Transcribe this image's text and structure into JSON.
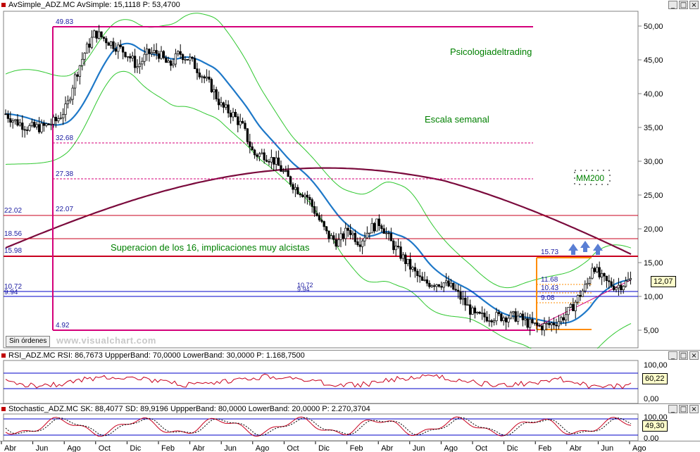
{
  "main_panel": {
    "header": {
      "name": "AvSimple_ADZ.MC",
      "indicator": "AvSimple: 15,1118",
      "price": "P: 53,4700"
    },
    "annotations": {
      "brand": "Psicologiadeltrading",
      "scale": "Escala semanal",
      "breakout": "Superacion de los 16, implicaciones muy alcistas",
      "ma_label": "MM200"
    },
    "levels": [
      {
        "label": "49.83",
        "value": 49.83
      },
      {
        "label": "32.68",
        "value": 32.68
      },
      {
        "label": "27.38",
        "value": 27.38
      },
      {
        "label": "22.07",
        "value": 22.07
      },
      {
        "label": "22.02",
        "value": 22.02
      },
      {
        "label": "18.56",
        "value": 18.56
      },
      {
        "label": "15.98",
        "value": 15.98
      },
      {
        "label": "15.73",
        "value": 15.73
      },
      {
        "label": "11.68",
        "value": 11.68
      },
      {
        "label": "10.72",
        "value": 10.72
      },
      {
        "label": "10.43",
        "value": 10.43
      },
      {
        "label": "9.94",
        "value": 9.94
      },
      {
        "label": "9.08",
        "value": 9.08
      },
      {
        "label": "4.92",
        "value": 4.92
      }
    ],
    "y_ticks": [
      "50,00",
      "45,00",
      "40,00",
      "35,00",
      "30,00",
      "25,00",
      "20,00",
      "15,00",
      "10,00",
      "5,00"
    ],
    "last_value": "12,07",
    "orders_button": "Sin órdenes",
    "watermark": "www.visualchart.com"
  },
  "rsi_panel": {
    "header": {
      "name": "RSI_ADZ.MC",
      "indicator": "RSI: 86,7673",
      "upper": "UppperBand: 70,0000",
      "lower": "LowerBand: 30,0000",
      "price": "P: 1.168,7500"
    },
    "y_ticks": [
      "100,00",
      "0,00"
    ],
    "last_value": "60,22"
  },
  "stoch_panel": {
    "header": {
      "name": "Stochastic_ADZ.MC",
      "indicator": "SK: 88,4077",
      "sd": "SD: 89,9196",
      "upper": "UppperBand: 80,0000",
      "lower": "LowerBand: 20,0000",
      "price": "P: 2.270,3704"
    },
    "y_ticks": [
      "100,00",
      "0,00"
    ],
    "last_value": "49,30"
  },
  "date_axis": [
    "Abr",
    "Jun",
    "Ago",
    "Oct",
    "Dic",
    "Feb",
    "Abr",
    "Jun",
    "Ago",
    "Oct",
    "Dic",
    "Feb",
    "Abr",
    "Jun",
    "Ago",
    "Oct",
    "Dic",
    "Feb",
    "Abr",
    "Jun",
    "Ago"
  ],
  "colors": {
    "magenta": "#d4007a",
    "red": "#c8001e",
    "blue": "#0000c8",
    "ma_blue": "#1e78c8",
    "ma200": "#7a0a3c",
    "bands": "#30c830",
    "orange": "#ff8c00",
    "arrow": "#5a7fd4",
    "green_text": "#008000"
  },
  "window_buttons": [
    "_",
    "□",
    "×"
  ]
}
